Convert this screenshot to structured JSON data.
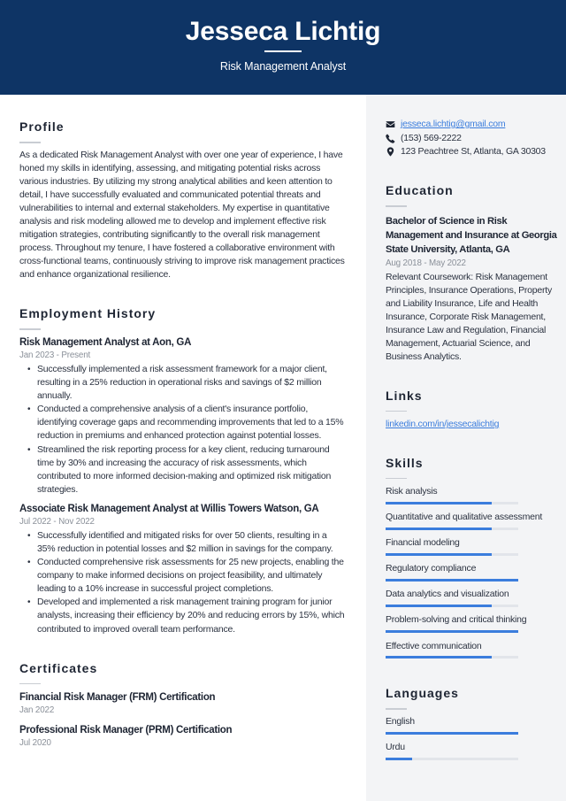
{
  "colors": {
    "header_bg": "#0e3465",
    "accent": "#3b7ddd",
    "sidebar_bg": "#f3f4f6"
  },
  "header": {
    "name": "Jesseca Lichtig",
    "title": "Risk Management Analyst"
  },
  "profile": {
    "heading": "Profile",
    "text": "As a dedicated Risk Management Analyst with over one year of experience, I have honed my skills in identifying, assessing, and mitigating potential risks across various industries. By utilizing my strong analytical abilities and keen attention to detail, I have successfully evaluated and communicated potential threats and vulnerabilities to internal and external stakeholders. My expertise in quantitative analysis and risk modeling allowed me to develop and implement effective risk mitigation strategies, contributing significantly to the overall risk management process. Throughout my tenure, I have fostered a collaborative environment with cross-functional teams, continuously striving to improve risk management practices and enhance organizational resilience."
  },
  "employment": {
    "heading": "Employment History",
    "jobs": [
      {
        "title": "Risk Management Analyst at Aon, GA",
        "dates": "Jan 2023 - Present",
        "bullets": [
          "Successfully implemented a risk assessment framework for a major client, resulting in a 25% reduction in operational risks and savings of $2 million annually.",
          "Conducted a comprehensive analysis of a client's insurance portfolio, identifying coverage gaps and recommending improvements that led to a 15% reduction in premiums and enhanced protection against potential losses.",
          "Streamlined the risk reporting process for a key client, reducing turnaround time by 30% and increasing the accuracy of risk assessments, which contributed to more informed decision-making and optimized risk mitigation strategies."
        ]
      },
      {
        "title": "Associate Risk Management Analyst at Willis Towers Watson, GA",
        "dates": "Jul 2022 - Nov 2022",
        "bullets": [
          "Successfully identified and mitigated risks for over 50 clients, resulting in a 35% reduction in potential losses and $2 million in savings for the company.",
          "Conducted comprehensive risk assessments for 25 new projects, enabling the company to make informed decisions on project feasibility, and ultimately leading to a 10% increase in successful project completions.",
          "Developed and implemented a risk management training program for junior analysts, increasing their efficiency by 20% and reducing errors by 15%, which contributed to improved overall team performance."
        ]
      }
    ]
  },
  "certificates": {
    "heading": "Certificates",
    "items": [
      {
        "name": "Financial Risk Manager (FRM) Certification",
        "date": "Jan 2022"
      },
      {
        "name": "Professional Risk Manager (PRM) Certification",
        "date": "Jul 2020"
      }
    ]
  },
  "contact": {
    "email": "jesseca.lichtig@gmail.com",
    "phone": "(153) 569-2222",
    "address": "123 Peachtree St, Atlanta, GA 30303",
    "icons": [
      "envelope-icon",
      "phone-icon",
      "map-pin-icon"
    ]
  },
  "education": {
    "heading": "Education",
    "items": [
      {
        "degree": "Bachelor of Science in Risk Management and Insurance at Georgia State University, Atlanta, GA",
        "dates": "Aug 2018 - May 2022",
        "description": "Relevant Coursework: Risk Management Principles, Insurance Operations, Property and Liability Insurance, Life and Health Insurance, Corporate Risk Management, Insurance Law and Regulation, Financial Management, Actuarial Science, and Business Analytics."
      }
    ]
  },
  "links": {
    "heading": "Links",
    "items": [
      {
        "label": "linkedin.com/in/jessecalichtig"
      }
    ]
  },
  "skills": {
    "heading": "Skills",
    "items": [
      {
        "name": "Risk analysis",
        "level": 80
      },
      {
        "name": "Quantitative and qualitative assessment",
        "level": 80
      },
      {
        "name": "Financial modeling",
        "level": 80
      },
      {
        "name": "Regulatory compliance",
        "level": 100
      },
      {
        "name": "Data analytics and visualization",
        "level": 80
      },
      {
        "name": "Problem-solving and critical thinking",
        "level": 100
      },
      {
        "name": "Effective communication",
        "level": 80
      }
    ]
  },
  "languages": {
    "heading": "Languages",
    "items": [
      {
        "name": "English",
        "level": 100
      },
      {
        "name": "Urdu",
        "level": 20
      }
    ]
  }
}
